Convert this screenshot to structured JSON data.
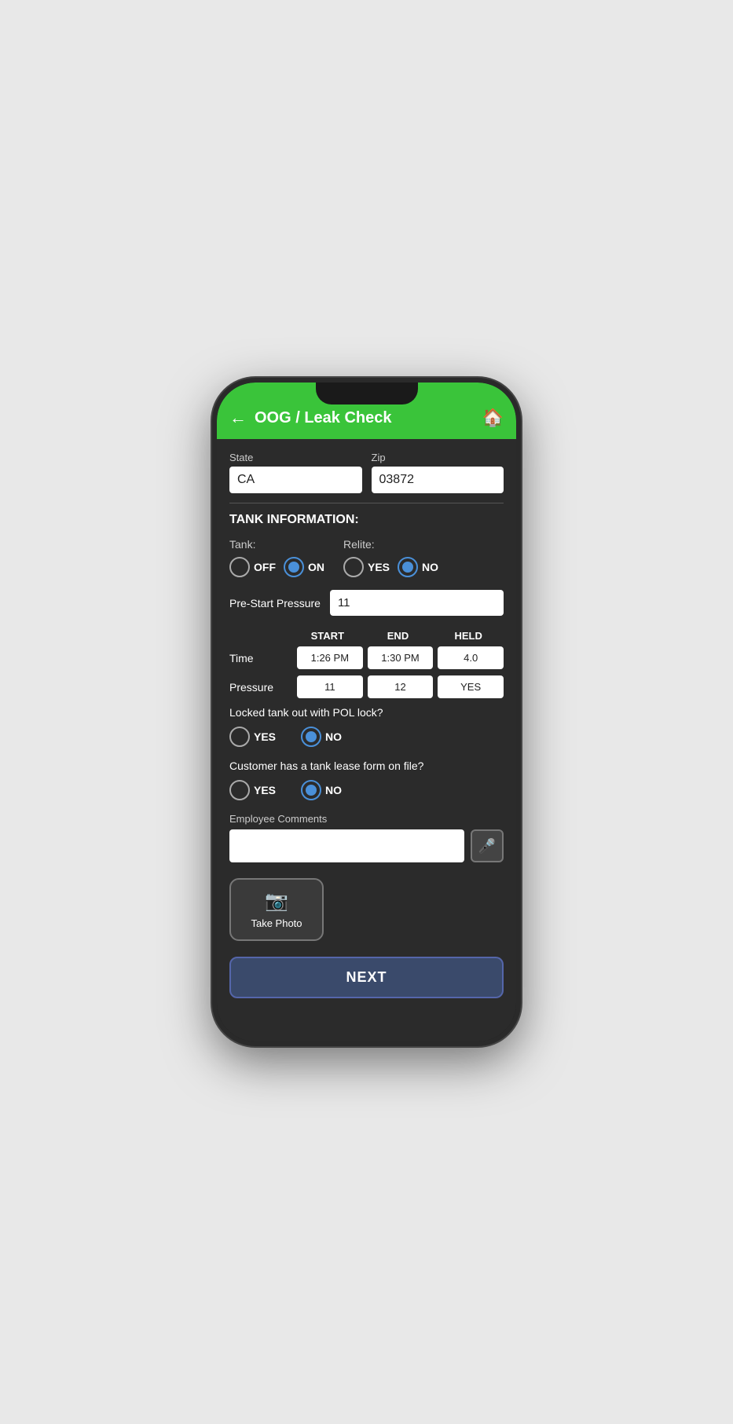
{
  "header": {
    "title": "OOG / Leak Check",
    "back_label": "←",
    "home_label": "🏠"
  },
  "location": {
    "state_label": "State",
    "state_value": "CA",
    "zip_label": "Zip",
    "zip_value": "03872"
  },
  "tank_section": {
    "heading": "TANK INFORMATION:",
    "tank_label": "Tank:",
    "tank_off_label": "OFF",
    "tank_on_label": "ON",
    "tank_selected": "ON",
    "relite_label": "Relite:",
    "relite_yes_label": "YES",
    "relite_no_label": "NO",
    "relite_selected": "NO",
    "pre_start_label": "Pre-Start Pressure",
    "pre_start_value": "11"
  },
  "table": {
    "col_blank": "",
    "col_start": "START",
    "col_end": "END",
    "col_held": "HELD",
    "time_label": "Time",
    "time_start": "1:26 PM",
    "time_end": "1:30 PM",
    "time_held": "4.0",
    "pressure_label": "Pressure",
    "pressure_start": "11",
    "pressure_end": "12",
    "pressure_held": "YES"
  },
  "pol_lock": {
    "question": "Locked tank out with POL lock?",
    "yes_label": "YES",
    "no_label": "NO",
    "selected": "NO"
  },
  "tank_lease": {
    "question": "Customer has a tank lease form on file?",
    "yes_label": "YES",
    "no_label": "NO",
    "selected": "NO"
  },
  "comments": {
    "label": "Employee Comments",
    "placeholder": "",
    "value": ""
  },
  "photo": {
    "label": "Take Photo"
  },
  "next_btn": {
    "label": "NEXT"
  }
}
